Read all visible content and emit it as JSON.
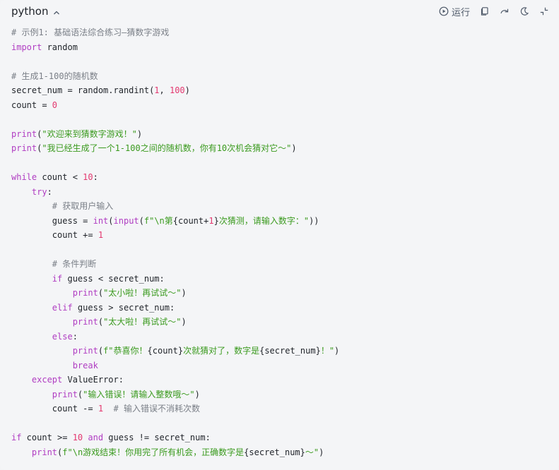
{
  "header": {
    "language": "python",
    "run_label": "运行",
    "icons": [
      "chevron-up-icon",
      "play-circle-icon",
      "copy-icon",
      "redo-icon",
      "theme-moon-icon",
      "collapse-icon"
    ]
  },
  "colors": {
    "comment": "#7a7f87",
    "keyword": "#b03dc2",
    "string": "#3a9a1e",
    "number": "#e3386f",
    "text": "#1f2329",
    "background": "#f4f5f7"
  },
  "code": {
    "lines": [
      [
        {
          "t": "cm",
          "v": "# 示例1: 基础语法综合练习—猜数字游戏"
        }
      ],
      [
        {
          "t": "kw",
          "v": "import"
        },
        {
          "t": "pl",
          "v": " random"
        }
      ],
      [],
      [
        {
          "t": "cm",
          "v": "# 生成1-100的随机数"
        }
      ],
      [
        {
          "t": "pl",
          "v": "secret_num = random.randint("
        },
        {
          "t": "num",
          "v": "1"
        },
        {
          "t": "pl",
          "v": ", "
        },
        {
          "t": "num",
          "v": "100"
        },
        {
          "t": "pl",
          "v": ")"
        }
      ],
      [
        {
          "t": "pl",
          "v": "count = "
        },
        {
          "t": "num",
          "v": "0"
        }
      ],
      [],
      [
        {
          "t": "fn",
          "v": "print"
        },
        {
          "t": "pl",
          "v": "("
        },
        {
          "t": "str",
          "v": "\"欢迎来到猜数字游戏！\""
        },
        {
          "t": "pl",
          "v": ")"
        }
      ],
      [
        {
          "t": "fn",
          "v": "print"
        },
        {
          "t": "pl",
          "v": "("
        },
        {
          "t": "str",
          "v": "\"我已经生成了一个1-100之间的随机数，你有10次机会猜对它～\""
        },
        {
          "t": "pl",
          "v": ")"
        }
      ],
      [],
      [
        {
          "t": "kw",
          "v": "while"
        },
        {
          "t": "pl",
          "v": " count < "
        },
        {
          "t": "num",
          "v": "10"
        },
        {
          "t": "pl",
          "v": ":"
        }
      ],
      [
        {
          "t": "pl",
          "v": "    "
        },
        {
          "t": "kw",
          "v": "try"
        },
        {
          "t": "pl",
          "v": ":"
        }
      ],
      [
        {
          "t": "pl",
          "v": "        "
        },
        {
          "t": "cm",
          "v": "# 获取用户输入"
        }
      ],
      [
        {
          "t": "pl",
          "v": "        guess = "
        },
        {
          "t": "fn",
          "v": "int"
        },
        {
          "t": "pl",
          "v": "("
        },
        {
          "t": "fn",
          "v": "input"
        },
        {
          "t": "pl",
          "v": "("
        },
        {
          "t": "str",
          "v": "f\"\\n第"
        },
        {
          "t": "pl",
          "v": "{count+"
        },
        {
          "t": "num",
          "v": "1"
        },
        {
          "t": "pl",
          "v": "}"
        },
        {
          "t": "str",
          "v": "次猜测，请输入数字：\""
        },
        {
          "t": "pl",
          "v": "))"
        }
      ],
      [
        {
          "t": "pl",
          "v": "        count += "
        },
        {
          "t": "num",
          "v": "1"
        }
      ],
      [],
      [
        {
          "t": "pl",
          "v": "        "
        },
        {
          "t": "cm",
          "v": "# 条件判断"
        }
      ],
      [
        {
          "t": "pl",
          "v": "        "
        },
        {
          "t": "kw",
          "v": "if"
        },
        {
          "t": "pl",
          "v": " guess < secret_num:"
        }
      ],
      [
        {
          "t": "pl",
          "v": "            "
        },
        {
          "t": "fn",
          "v": "print"
        },
        {
          "t": "pl",
          "v": "("
        },
        {
          "t": "str",
          "v": "\"太小啦！再试试～\""
        },
        {
          "t": "pl",
          "v": ")"
        }
      ],
      [
        {
          "t": "pl",
          "v": "        "
        },
        {
          "t": "kw",
          "v": "elif"
        },
        {
          "t": "pl",
          "v": " guess > secret_num:"
        }
      ],
      [
        {
          "t": "pl",
          "v": "            "
        },
        {
          "t": "fn",
          "v": "print"
        },
        {
          "t": "pl",
          "v": "("
        },
        {
          "t": "str",
          "v": "\"太大啦！再试试～\""
        },
        {
          "t": "pl",
          "v": ")"
        }
      ],
      [
        {
          "t": "pl",
          "v": "        "
        },
        {
          "t": "kw",
          "v": "else"
        },
        {
          "t": "pl",
          "v": ":"
        }
      ],
      [
        {
          "t": "pl",
          "v": "            "
        },
        {
          "t": "fn",
          "v": "print"
        },
        {
          "t": "pl",
          "v": "("
        },
        {
          "t": "str",
          "v": "f\"恭喜你！"
        },
        {
          "t": "pl",
          "v": "{count}"
        },
        {
          "t": "str",
          "v": "次就猜对了，数字是"
        },
        {
          "t": "pl",
          "v": "{secret_num}"
        },
        {
          "t": "str",
          "v": "！\""
        },
        {
          "t": "pl",
          "v": ")"
        }
      ],
      [
        {
          "t": "pl",
          "v": "            "
        },
        {
          "t": "kw",
          "v": "break"
        }
      ],
      [
        {
          "t": "pl",
          "v": "    "
        },
        {
          "t": "kw",
          "v": "except"
        },
        {
          "t": "pl",
          "v": " ValueError:"
        }
      ],
      [
        {
          "t": "pl",
          "v": "        "
        },
        {
          "t": "fn",
          "v": "print"
        },
        {
          "t": "pl",
          "v": "("
        },
        {
          "t": "str",
          "v": "\"输入错误！请输入整数哦～\""
        },
        {
          "t": "pl",
          "v": ")"
        }
      ],
      [
        {
          "t": "pl",
          "v": "        count -= "
        },
        {
          "t": "num",
          "v": "1"
        },
        {
          "t": "pl",
          "v": "  "
        },
        {
          "t": "cm",
          "v": "# 输入错误不消耗次数"
        }
      ],
      [],
      [
        {
          "t": "kw",
          "v": "if"
        },
        {
          "t": "pl",
          "v": " count >= "
        },
        {
          "t": "num",
          "v": "10"
        },
        {
          "t": "pl",
          "v": " "
        },
        {
          "t": "kw",
          "v": "and"
        },
        {
          "t": "pl",
          "v": " guess != secret_num:"
        }
      ],
      [
        {
          "t": "pl",
          "v": "    "
        },
        {
          "t": "fn",
          "v": "print"
        },
        {
          "t": "pl",
          "v": "("
        },
        {
          "t": "str",
          "v": "f\"\\n游戏结束！你用完了所有机会，正确数字是"
        },
        {
          "t": "pl",
          "v": "{secret_num}"
        },
        {
          "t": "str",
          "v": "～\""
        },
        {
          "t": "pl",
          "v": ")"
        }
      ]
    ]
  }
}
